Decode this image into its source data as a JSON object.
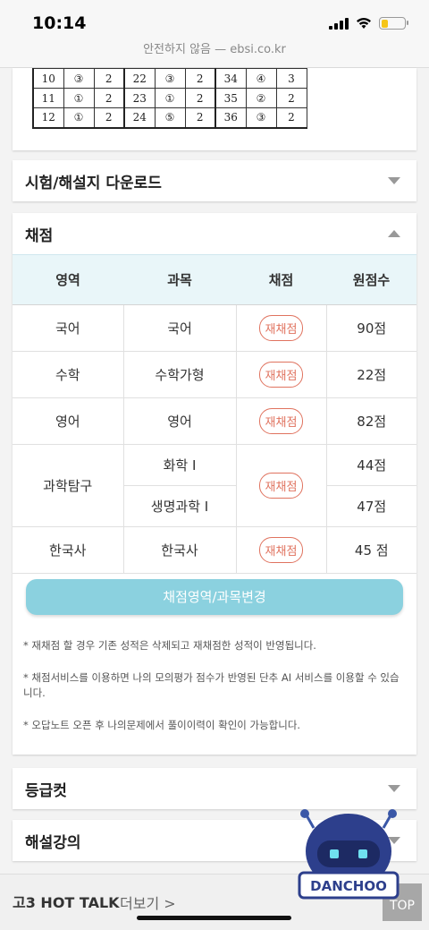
{
  "status": {
    "time": "10:14"
  },
  "browser": {
    "url_text": "안전하지 않음 — ebsi.co.kr"
  },
  "answer_table": {
    "rows": [
      [
        "10",
        "③",
        "2",
        "22",
        "③",
        "2",
        "34",
        "④",
        "3"
      ],
      [
        "11",
        "①",
        "2",
        "23",
        "①",
        "2",
        "35",
        "②",
        "2"
      ],
      [
        "12",
        "①",
        "2",
        "24",
        "⑤",
        "2",
        "36",
        "③",
        "2"
      ]
    ]
  },
  "sections": {
    "download": {
      "title": "시험/해설지 다운로드"
    },
    "grading": {
      "title": "채점"
    },
    "grade_cut": {
      "title": "등급컷"
    },
    "lecture": {
      "title": "해설강의"
    }
  },
  "grading_table": {
    "headers": [
      "영역",
      "과목",
      "채점",
      "원점수"
    ],
    "regrade_label": "재채점",
    "rows": [
      {
        "area": "국어",
        "subject": "국어",
        "score": "90점"
      },
      {
        "area": "수학",
        "subject": "수학가형",
        "score": "22점"
      },
      {
        "area": "영어",
        "subject": "영어",
        "score": "82점"
      },
      {
        "area": "과학탐구",
        "subject": "화학 Ⅰ",
        "score": "44점",
        "subject2": "생명과학 Ⅰ",
        "score2": "47점"
      },
      {
        "area": "한국사",
        "subject": "한국사",
        "score": "45 점"
      }
    ]
  },
  "change_button": "채점영역/과목변경",
  "notes": [
    "* 재채점 할 경우 기존 성적은 삭제되고 재채점한 성적이 반영됩니다.",
    "* 채점서비스를 이용하면 나의 모의평가 점수가 반영된 단추 AI 서비스를 이용할 수 있습니다.",
    "* 오답노트 오픈 후 나의문제에서 풀이이력이 확인이 가능합니다."
  ],
  "mascot": {
    "label": "DANCHOO"
  },
  "bottom": {
    "hot_talk": "고3 HOT TALK",
    "more": "더보기 >",
    "top": "TOP"
  },
  "colors": {
    "accent_button": "#8bd1df",
    "regrade": "#e0735f",
    "header_bg": "#e9f6f9"
  }
}
